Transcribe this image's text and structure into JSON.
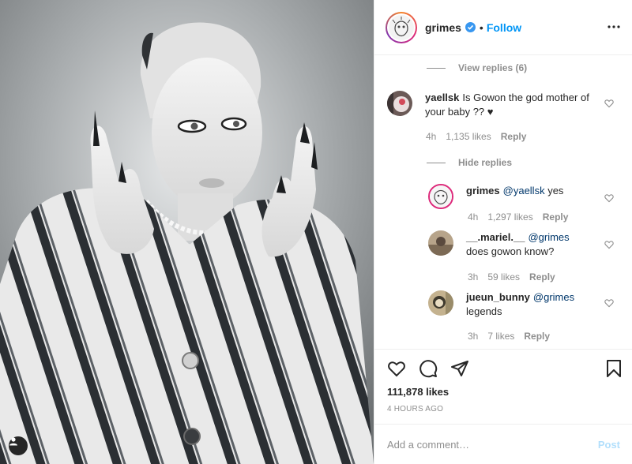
{
  "post": {
    "photo_alt": "grimes post photo",
    "tag_icon": "user-tag-icon"
  },
  "header": {
    "username": "grimes",
    "separator": "•",
    "follow_label": "Follow",
    "more_icon": "more-options-icon"
  },
  "comments": {
    "view_replies_1": "View replies (6)",
    "hide_replies": "Hide replies",
    "items": [
      {
        "user": "yaellsk",
        "text": "Is Gowon the god mother of your baby ?? ♥",
        "time": "4h",
        "likes": "1,135 likes",
        "reply": "Reply"
      }
    ],
    "replies": [
      {
        "user": "grimes",
        "mention": "@yaellsk",
        "text": " yes",
        "time": "4h",
        "likes": "1,297 likes",
        "reply": "Reply"
      },
      {
        "user": "__.mariel.__",
        "mention": "@grimes",
        "text": "does gowon know?",
        "time": "3h",
        "likes": "59 likes",
        "reply": "Reply"
      },
      {
        "user": "jueun_bunny",
        "mention": "@grimes",
        "text": "legends",
        "time": "3h",
        "likes": "7 likes",
        "reply": "Reply"
      }
    ]
  },
  "actions": {
    "likes": "111,878 likes",
    "time_ago": "4 HOURS AGO"
  },
  "add_comment": {
    "placeholder": "Add a comment…",
    "value": "",
    "post_label": "Post"
  },
  "colors": {
    "accent": "#0095f6",
    "verified": "#3897f0",
    "muted": "#8e8e8e",
    "post_disabled": "#b2dffc"
  }
}
